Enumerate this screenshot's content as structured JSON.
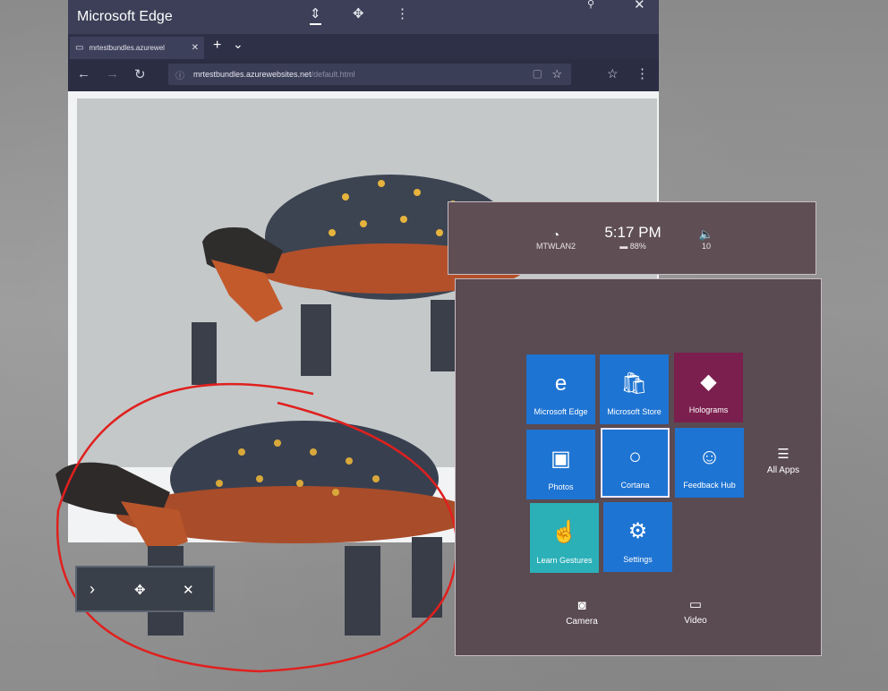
{
  "edge": {
    "title": "Microsoft Edge",
    "titlebar_icons": [
      "move-icon",
      "adjust-icon",
      "more-icon",
      "follow-icon",
      "close-icon"
    ],
    "tab": {
      "label": "mrtestbundles.azurewel",
      "close": "✕"
    },
    "tab_new": "+",
    "tab_list": "⌄",
    "nav": {
      "back": "←",
      "forward": "→",
      "refresh": "↻"
    },
    "address": {
      "host": "mrtestbundles.azurewebsites.net",
      "path": "/default.html"
    },
    "favorite": "☆",
    "hub": "☆",
    "more": "⋮"
  },
  "start": {
    "network": {
      "name": "MTWLAN2"
    },
    "clock": {
      "time": "5:17 PM",
      "battery": "88%"
    },
    "volume": {
      "level": "10"
    },
    "tiles": [
      {
        "label": "Microsoft Edge",
        "icon": "e",
        "color": "#1e74d2"
      },
      {
        "label": "Microsoft Store",
        "icon": "🛍",
        "color": "#1e74d2"
      },
      {
        "label": "Holograms",
        "icon": "◆",
        "color": "#7b1f4e"
      },
      {
        "label": "Photos",
        "icon": "▣",
        "color": "#1e74d2"
      },
      {
        "label": "Cortana",
        "icon": "○",
        "color": "#1e74d2"
      },
      {
        "label": "Feedback Hub",
        "icon": "☺",
        "color": "#1e74d2"
      },
      {
        "label": "Learn Gestures",
        "icon": "☝",
        "color": "#2bb0b8"
      },
      {
        "label": "Settings",
        "icon": "⚙",
        "color": "#1e74d2"
      }
    ],
    "all_apps": "All Apps",
    "camera": "Camera",
    "video": "Video"
  },
  "appbar": {
    "chevron": "›",
    "adjust": "✥",
    "close": "✕"
  }
}
